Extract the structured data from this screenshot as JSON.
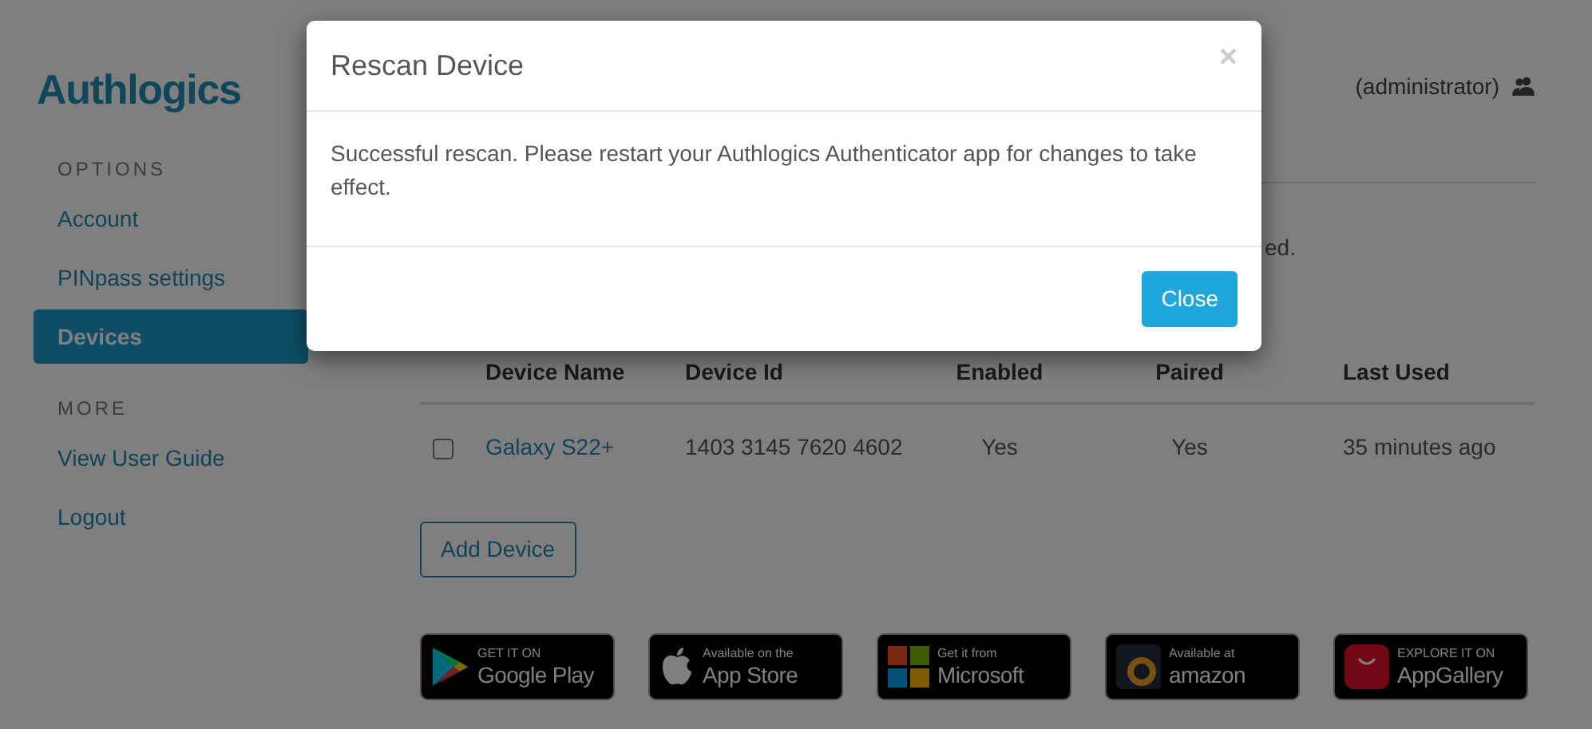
{
  "brand": {
    "logo": "Authlogics"
  },
  "header": {
    "user": "(administrator)"
  },
  "sidebar": {
    "sections": [
      {
        "heading": "OPTIONS",
        "items": [
          {
            "label": "Account",
            "selected": false
          },
          {
            "label": "PINpass settings",
            "selected": false
          },
          {
            "label": "Devices",
            "selected": true
          }
        ]
      },
      {
        "heading": "MORE",
        "items": [
          {
            "label": "View User Guide",
            "selected": false
          },
          {
            "label": "Logout",
            "selected": false
          }
        ]
      }
    ]
  },
  "notice": "ed.",
  "table": {
    "columns": [
      "Device Name",
      "Device Id",
      "Enabled",
      "Paired",
      "Last Used"
    ],
    "rows": [
      {
        "checked": false,
        "name": "Galaxy S22+",
        "device_id": "1403 3145 7620 4602",
        "enabled": "Yes",
        "paired": "Yes",
        "last_used": "35 minutes ago"
      }
    ]
  },
  "add_button": "Add Device",
  "store_badges": [
    {
      "kind": "google",
      "line1": "GET IT ON",
      "line2": "Google Play"
    },
    {
      "kind": "apple",
      "line1": "Available on the",
      "line2": "App Store"
    },
    {
      "kind": "microsoft",
      "line1": "Get it from",
      "line2": "Microsoft"
    },
    {
      "kind": "amazon",
      "line1": "Available at",
      "line2": "amazon"
    },
    {
      "kind": "huawei",
      "line1": "EXPLORE IT ON",
      "line2": "AppGallery"
    }
  ],
  "dialog": {
    "title": "Rescan Device",
    "close_glyph": "×",
    "message": "Successful rescan. Please restart your Authlogics Authenticator app for changes to take effect.",
    "button": "Close"
  }
}
